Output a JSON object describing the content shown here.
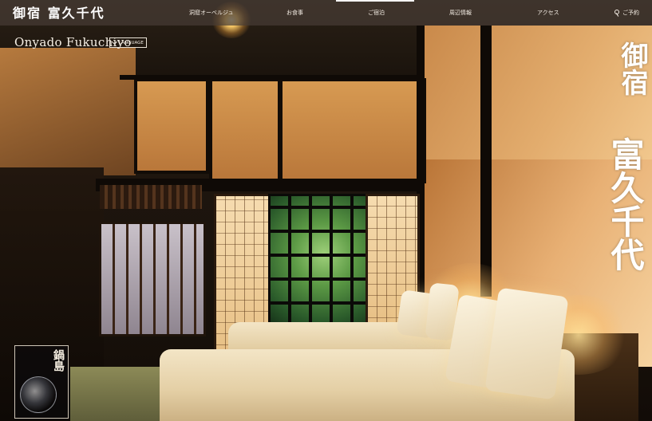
{
  "header": {
    "logo_text": "御宿 富久千代",
    "nav": [
      {
        "label": "洞窟オーベルジュ"
      },
      {
        "label": "お食事"
      },
      {
        "label": "ご宿泊"
      },
      {
        "label": "周辺情報"
      },
      {
        "label": "アクセス"
      }
    ],
    "login_label": "ご予約"
  },
  "subheader": {
    "inn_name": "Onyado Fukuchiyo",
    "language_button": "LANGUAGE"
  },
  "hero": {
    "calligraphy_top": "御宿",
    "calligraphy_bottom": "富久千代"
  },
  "emblem": {
    "text": "鍋島"
  },
  "colors": {
    "topbar": "#463c34",
    "text_light": "#f3ece3",
    "wall_glow": "#e3ad6e"
  }
}
